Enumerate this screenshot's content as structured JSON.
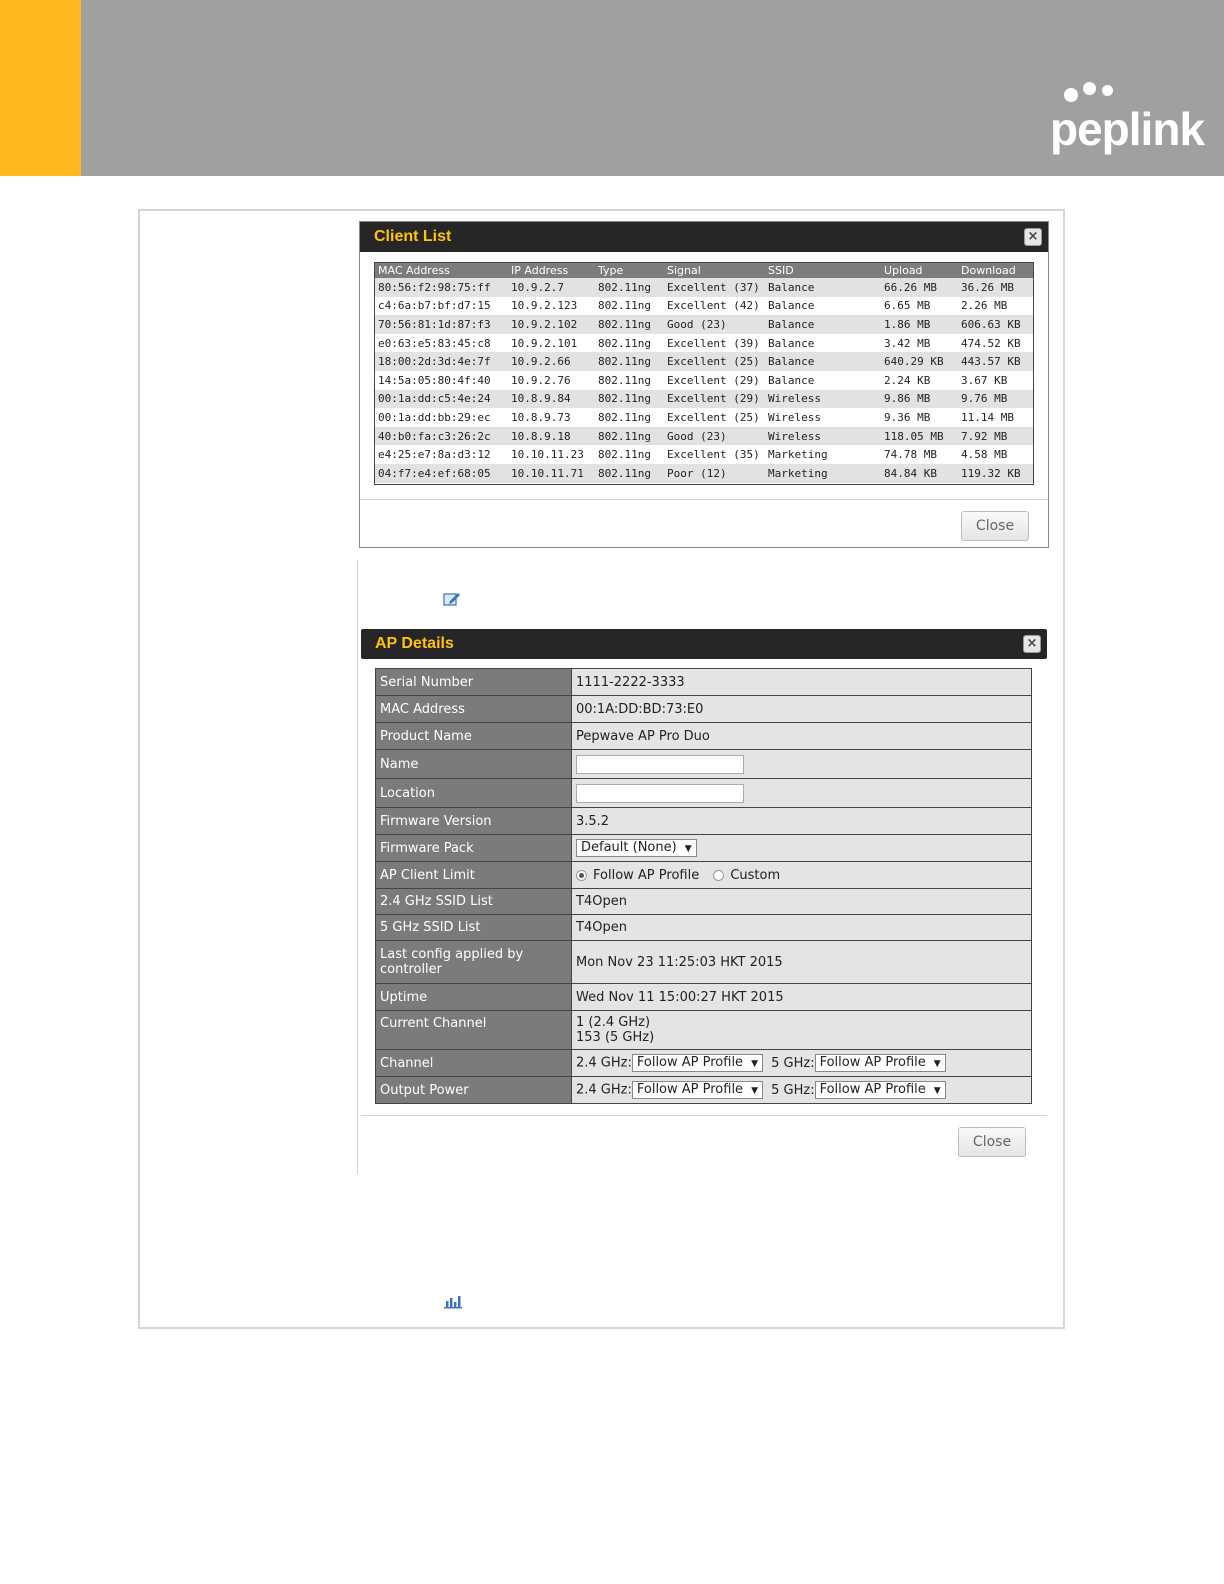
{
  "brand": {
    "logo_text": "peplink",
    "accent_color": "#ffb81c",
    "header_color": "#a0a0a0"
  },
  "client_list": {
    "title": "Client List",
    "close_label": "Close",
    "close_icon": "×",
    "columns": [
      "MAC Address",
      "IP Address",
      "Type",
      "Signal",
      "SSID",
      "Upload",
      "Download"
    ],
    "rows": [
      [
        "80:56:f2:98:75:ff",
        "10.9.2.7",
        "802.11ng",
        "Excellent (37)",
        "Balance",
        "66.26 MB",
        "36.26 MB"
      ],
      [
        "c4:6a:b7:bf:d7:15",
        "10.9.2.123",
        "802.11ng",
        "Excellent (42)",
        "Balance",
        "6.65 MB",
        "2.26 MB"
      ],
      [
        "70:56:81:1d:87:f3",
        "10.9.2.102",
        "802.11ng",
        "Good (23)",
        "Balance",
        "1.86 MB",
        "606.63 KB"
      ],
      [
        "e0:63:e5:83:45:c8",
        "10.9.2.101",
        "802.11ng",
        "Excellent (39)",
        "Balance",
        "3.42 MB",
        "474.52 KB"
      ],
      [
        "18:00:2d:3d:4e:7f",
        "10.9.2.66",
        "802.11ng",
        "Excellent (25)",
        "Balance",
        "640.29 KB",
        "443.57 KB"
      ],
      [
        "14:5a:05:80:4f:40",
        "10.9.2.76",
        "802.11ng",
        "Excellent (29)",
        "Balance",
        "2.24 KB",
        "3.67 KB"
      ],
      [
        "00:1a:dd:c5:4e:24",
        "10.8.9.84",
        "802.11ng",
        "Excellent (29)",
        "Wireless",
        "9.86 MB",
        "9.76 MB"
      ],
      [
        "00:1a:dd:bb:29:ec",
        "10.8.9.73",
        "802.11ng",
        "Excellent (25)",
        "Wireless",
        "9.36 MB",
        "11.14 MB"
      ],
      [
        "40:b0:fa:c3:26:2c",
        "10.8.9.18",
        "802.11ng",
        "Good (23)",
        "Wireless",
        "118.05 MB",
        "7.92 MB"
      ],
      [
        "e4:25:e7:8a:d3:12",
        "10.10.11.23",
        "802.11ng",
        "Excellent (35)",
        "Marketing",
        "74.78 MB",
        "4.58 MB"
      ],
      [
        "04:f7:e4:ef:68:05",
        "10.10.11.71",
        "802.11ng",
        "Poor (12)",
        "Marketing",
        "84.84 KB",
        "119.32 KB"
      ]
    ]
  },
  "icons": {
    "edit": "edit-icon",
    "chart": "bar-chart-icon"
  },
  "ap_details": {
    "title": "AP Details",
    "close_label": "Close",
    "close_icon": "×",
    "serial_label": "Serial Number",
    "serial_value": "1111-2222-3333",
    "mac_label": "MAC Address",
    "mac_value": "00:1A:DD:BD:73:E0",
    "product_label": "Product Name",
    "product_value": "Pepwave AP Pro Duo",
    "name_label": "Name",
    "name_value": "",
    "location_label": "Location",
    "location_value": "",
    "firmware_version_label": "Firmware Version",
    "firmware_version_value": "3.5.2",
    "firmware_pack_label": "Firmware Pack",
    "firmware_pack_value": "Default (None)",
    "client_limit_label": "AP Client Limit",
    "client_limit_option_follow": "Follow AP Profile",
    "client_limit_option_custom": "Custom",
    "ssid24_label": "2.4 GHz SSID List",
    "ssid24_value": "T4Open",
    "ssid5_label": "5 GHz SSID List",
    "ssid5_value": "T4Open",
    "last_config_label": "Last config applied by controller",
    "last_config_value": "Mon Nov 23 11:25:03 HKT 2015",
    "uptime_label": "Uptime",
    "uptime_value": "Wed Nov 11 15:00:27 HKT 2015",
    "current_channel_label": "Current Channel",
    "current_channel_24": "1 (2.4 GHz)",
    "current_channel_5": "153 (5 GHz)",
    "channel_label": "Channel",
    "output_power_label": "Output Power",
    "band24_prefix": "2.4 GHz:",
    "band5_prefix": "5 GHz:",
    "channel_24_value": "Follow AP Profile",
    "channel_5_value": "Follow AP Profile",
    "power_24_value": "Follow AP Profile",
    "power_5_value": "Follow AP Profile",
    "dropdown_arrow": "▼"
  }
}
